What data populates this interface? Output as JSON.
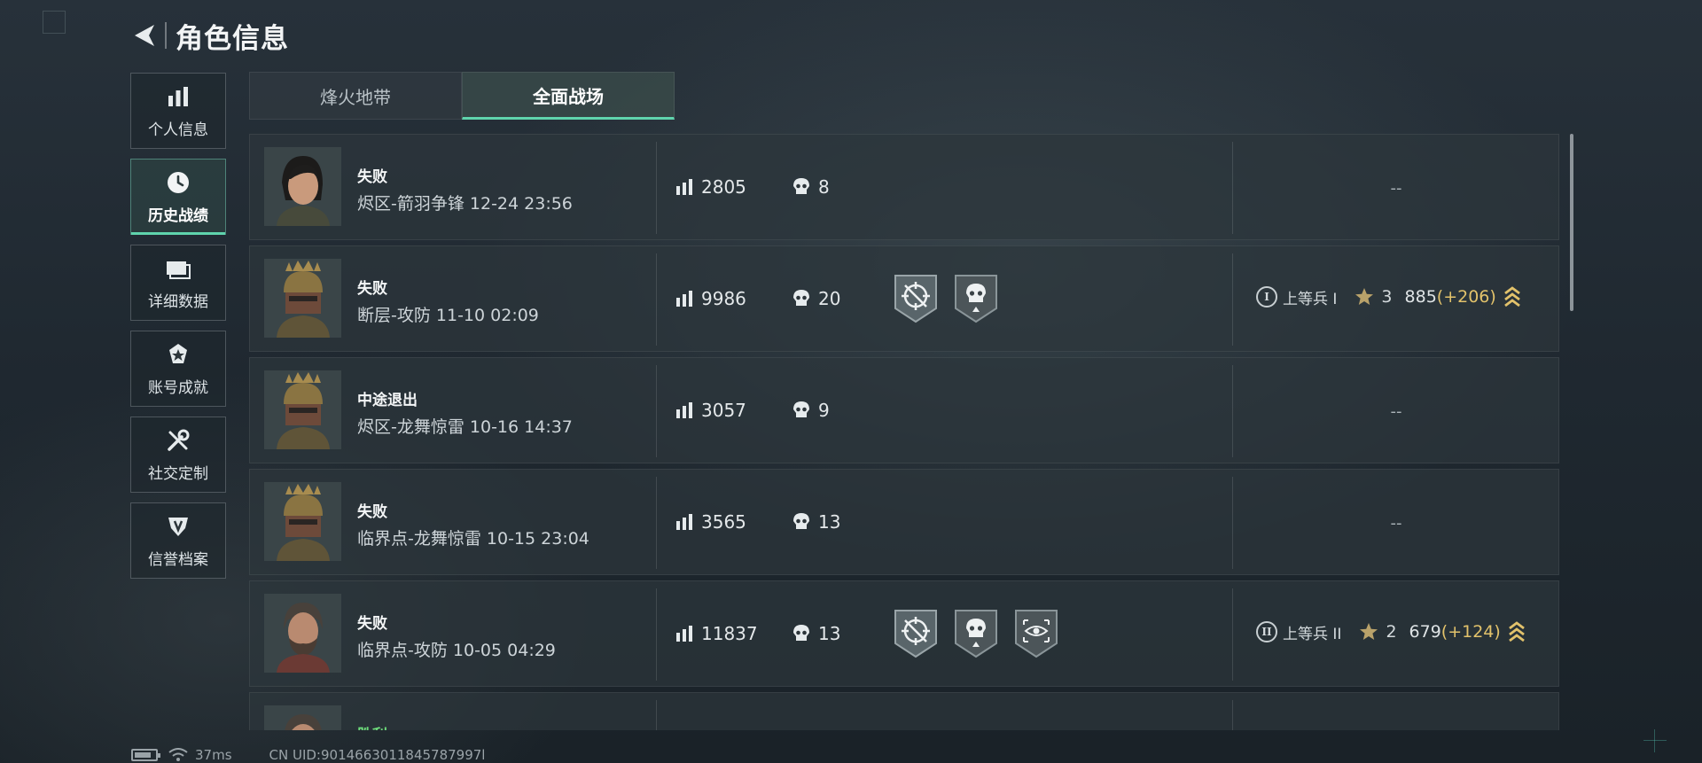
{
  "header": {
    "title": "角色信息"
  },
  "nav": [
    {
      "label": "个人信息",
      "icon": "bar-chart-icon",
      "active": false
    },
    {
      "label": "历史战绩",
      "icon": "clock-icon",
      "active": true
    },
    {
      "label": "详细数据",
      "icon": "cards-icon",
      "active": false
    },
    {
      "label": "账号成就",
      "icon": "achievement-icon",
      "active": false
    },
    {
      "label": "社交定制",
      "icon": "tools-icon",
      "active": false
    },
    {
      "label": "信誉档案",
      "icon": "shield-icon",
      "active": false
    }
  ],
  "tabs": [
    {
      "label": "烽火地带",
      "active": false
    },
    {
      "label": "全面战场",
      "active": true
    }
  ],
  "matches": [
    {
      "result": "失败",
      "win": false,
      "avatar": "female-operator",
      "map": "烬区-箭羽争锋 12-24 23:56",
      "score": "2805",
      "kills": "8",
      "badges": [],
      "rank": null,
      "empty_rank": "--"
    },
    {
      "result": "失败",
      "win": false,
      "avatar": "helmet-operator",
      "map": "断层-攻防 11-10 02:09",
      "score": "9986",
      "kills": "20",
      "badges": [
        "crosshair-badge",
        "skull-badge"
      ],
      "rank": {
        "numeral": "I",
        "name": "上等兵 I",
        "stars": "3",
        "points": "885",
        "delta": "(+206)"
      }
    },
    {
      "result": "中途退出",
      "win": false,
      "avatar": "helmet-operator",
      "map": "烬区-龙舞惊雷 10-16 14:37",
      "score": "3057",
      "kills": "9",
      "badges": [],
      "rank": null,
      "empty_rank": "--"
    },
    {
      "result": "失败",
      "win": false,
      "avatar": "helmet-operator",
      "map": "临界点-龙舞惊雷 10-15 23:04",
      "score": "3565",
      "kills": "13",
      "badges": [],
      "rank": null,
      "empty_rank": "--"
    },
    {
      "result": "失败",
      "win": false,
      "avatar": "bearded-operator",
      "map": "临界点-攻防 10-05 04:29",
      "score": "11837",
      "kills": "13",
      "badges": [
        "crosshair-badge",
        "skull-badge",
        "eye-badge"
      ],
      "rank": {
        "numeral": "II",
        "name": "上等兵 II",
        "stars": "2",
        "points": "679",
        "delta": "(+124)"
      }
    },
    {
      "result": "胜利",
      "win": true,
      "avatar": "bearded-operator",
      "map": "",
      "score": "",
      "kills": "",
      "badges": [],
      "rank": null,
      "empty_rank": ""
    }
  ],
  "status": {
    "latency": "37ms",
    "uid": "CN UID:9014663011845787997l"
  },
  "colors": {
    "accent": "#5fd4ad",
    "gold": "#e2c26b",
    "win": "#6ddc7b"
  }
}
